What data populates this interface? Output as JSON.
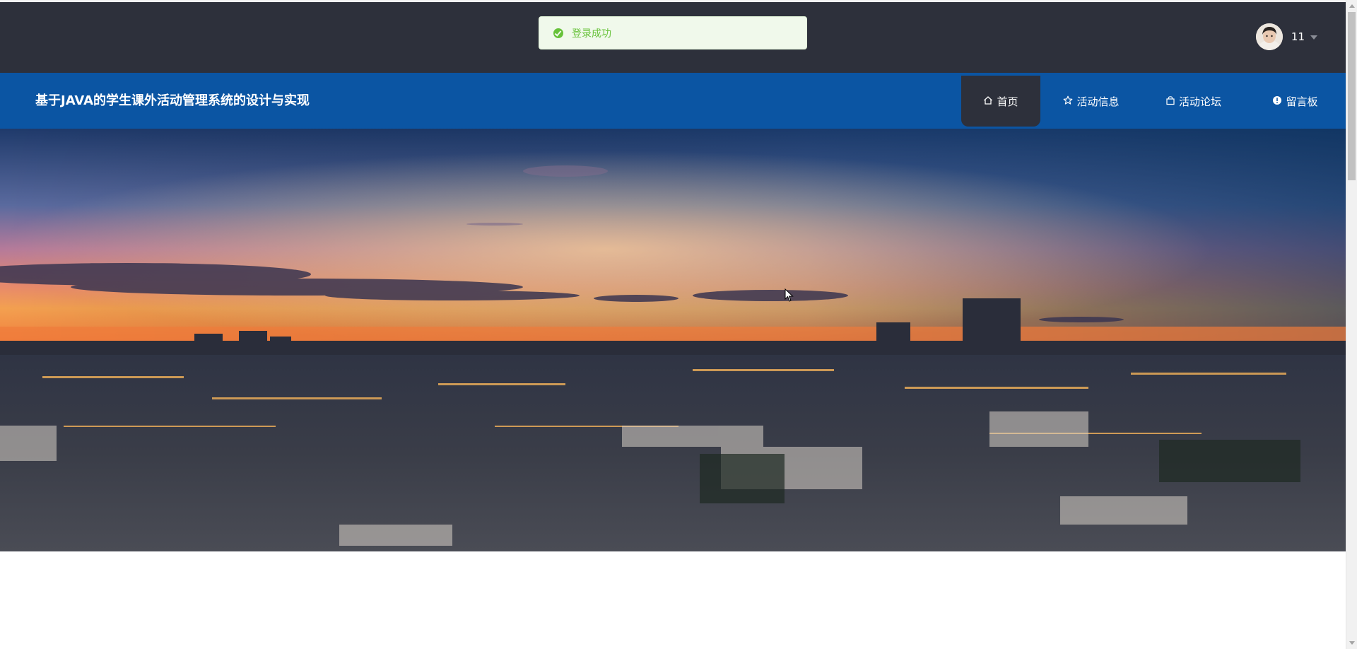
{
  "toast": {
    "message": "登录成功",
    "type": "success"
  },
  "user": {
    "name": "11",
    "avatar_icon": "user-avatar"
  },
  "header": {
    "site_title": "基于JAVA的学生课外活动管理系统的设计与实现"
  },
  "nav": {
    "items": [
      {
        "label": "首页",
        "icon": "home-icon",
        "active": true
      },
      {
        "label": "活动信息",
        "icon": "star-icon",
        "active": false
      },
      {
        "label": "活动论坛",
        "icon": "bag-icon",
        "active": false
      },
      {
        "label": "留言板",
        "icon": "info-icon",
        "active": false
      }
    ]
  },
  "banner": {
    "image": "city-skyline-at-sunset"
  },
  "colors": {
    "topbar": "#2d303b",
    "navbar": "#0b55a3",
    "toast_bg": "#f0f9eb",
    "toast_text": "#67c23a"
  }
}
